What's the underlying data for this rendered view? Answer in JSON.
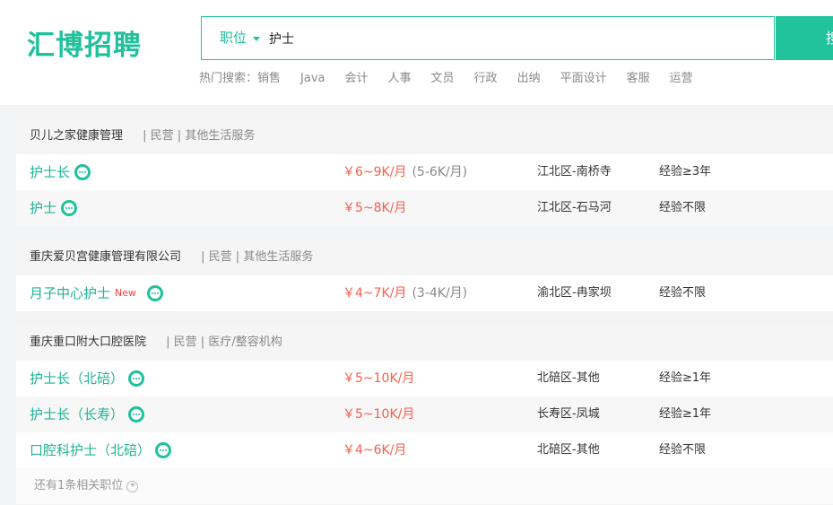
{
  "brand": {
    "logo_text": "汇博招聘",
    "accent": "#1fc19c",
    "salary_color": "#f55f4c"
  },
  "search": {
    "type_label": "职位",
    "query": "护士",
    "button_label": "搜索"
  },
  "hot_search": {
    "label": "热门搜索：",
    "items": [
      "销售",
      "Java",
      "会计",
      "人事",
      "文员",
      "行政",
      "出纳",
      "平面设计",
      "客服",
      "运营"
    ]
  },
  "companies": [
    {
      "name": "贝儿之家健康管理",
      "meta": "| 民营 | 其他生活服务",
      "jobs": [
        {
          "title": "护士长",
          "salary": "￥6~9K/月",
          "salary_sub": "(5-6K/月)",
          "location": "江北区-南桥寺",
          "experience": "经验≥3年",
          "icon": "chat-icon"
        },
        {
          "title": "护士",
          "salary": "￥5~8K/月",
          "salary_sub": "",
          "location": "江北区-石马河",
          "experience": "经验不限",
          "icon": "chat-icon"
        }
      ]
    },
    {
      "name": "重庆爱贝宫健康管理有限公司",
      "meta": "| 民营 | 其他生活服务",
      "jobs": [
        {
          "title": "月子中心护士",
          "badge": "New",
          "salary": "￥4~7K/月",
          "salary_sub": "(3-4K/月)",
          "location": "渝北区-冉家坝",
          "experience": "经验不限",
          "icon": "chat-icon"
        }
      ]
    },
    {
      "name": "重庆重口附大口腔医院",
      "meta": "| 民营 | 医疗/整容机构",
      "jobs": [
        {
          "title": "护士长（北碚）",
          "salary": "￥5~10K/月",
          "salary_sub": "",
          "location": "北碚区-其他",
          "experience": "经验≥1年",
          "icon": "chat-icon"
        },
        {
          "title": "护士长（长寿）",
          "salary": "￥5~10K/月",
          "salary_sub": "",
          "location": "长寿区-凤城",
          "experience": "经验≥1年",
          "icon": "chat-icon"
        },
        {
          "title": "口腔科护士（北碚）",
          "salary": "￥4~6K/月",
          "salary_sub": "",
          "location": "北碚区-其他",
          "experience": "经验不限",
          "icon": "chat-icon"
        }
      ],
      "more_text": "还有1条相关职位"
    }
  ]
}
